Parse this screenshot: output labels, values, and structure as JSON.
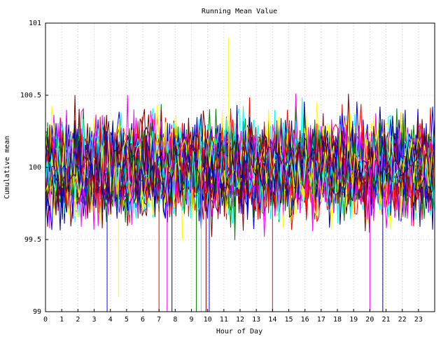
{
  "chart_data": {
    "type": "line",
    "title": "Running Mean Value",
    "xlabel": "Hour of Day",
    "ylabel": "Cumulative mean",
    "xlim": [
      0,
      24
    ],
    "ylim": [
      99,
      101
    ],
    "x_ticks": [
      0,
      1,
      2,
      3,
      4,
      5,
      6,
      7,
      8,
      9,
      10,
      11,
      12,
      13,
      14,
      15,
      16,
      17,
      18,
      19,
      20,
      21,
      22,
      23
    ],
    "y_ticks": [
      99,
      99.5,
      100,
      100.5,
      101
    ],
    "y_tick_labels": [
      "99",
      "99.5",
      "100",
      "100.5",
      "101"
    ],
    "grid": "dotted",
    "legend": "none",
    "series_colors": [
      "#ff0000",
      "#008000",
      "#0000ff",
      "#ff00ff",
      "#00ffff",
      "#ffff00",
      "#000080",
      "#800000"
    ],
    "series_count": 40,
    "center_value": 100,
    "typical_spread": 0.45,
    "spikes": [
      {
        "x": 3.8,
        "y": 99.0
      },
      {
        "x": 4.5,
        "y": 99.1
      },
      {
        "x": 7.0,
        "y": 99.0
      },
      {
        "x": 7.5,
        "y": 99.0
      },
      {
        "x": 7.8,
        "y": 99.0
      },
      {
        "x": 9.3,
        "y": 99.0
      },
      {
        "x": 9.6,
        "y": 99.0
      },
      {
        "x": 9.9,
        "y": 99.0
      },
      {
        "x": 10.1,
        "y": 99.0
      },
      {
        "x": 11.3,
        "y": 100.9
      },
      {
        "x": 14.0,
        "y": 99.0
      },
      {
        "x": 20.0,
        "y": 99.0
      },
      {
        "x": 20.8,
        "y": 99.0
      }
    ]
  }
}
